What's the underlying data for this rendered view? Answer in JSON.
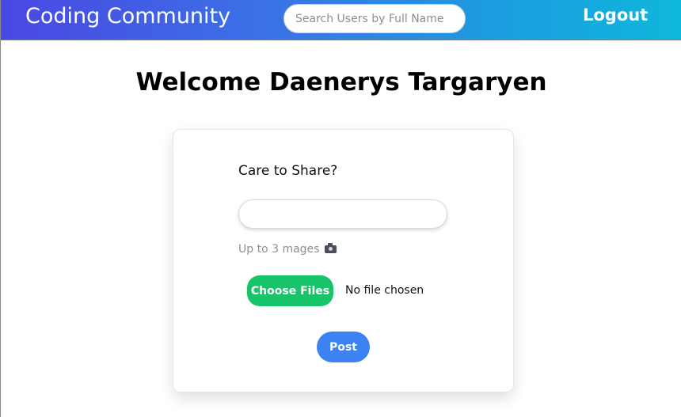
{
  "navbar": {
    "brand": "Coding Community",
    "search_placeholder": "Search Users by Full Name",
    "logout_label": "Logout"
  },
  "main": {
    "welcome": "Welcome Daenerys Targaryen"
  },
  "post_card": {
    "share_label": "Care to Share?",
    "post_input_value": "",
    "images_hint": "Up to 3 mages",
    "images_icon": "camera-icon",
    "choose_files_label": "Choose Files",
    "file_status": "No file chosen",
    "post_label": "Post"
  },
  "colors": {
    "nav_gradient_start": "#4a47e3",
    "nav_gradient_end": "#0fb7db",
    "choose_button": "#18c46a",
    "post_button": "#3d82f2"
  }
}
